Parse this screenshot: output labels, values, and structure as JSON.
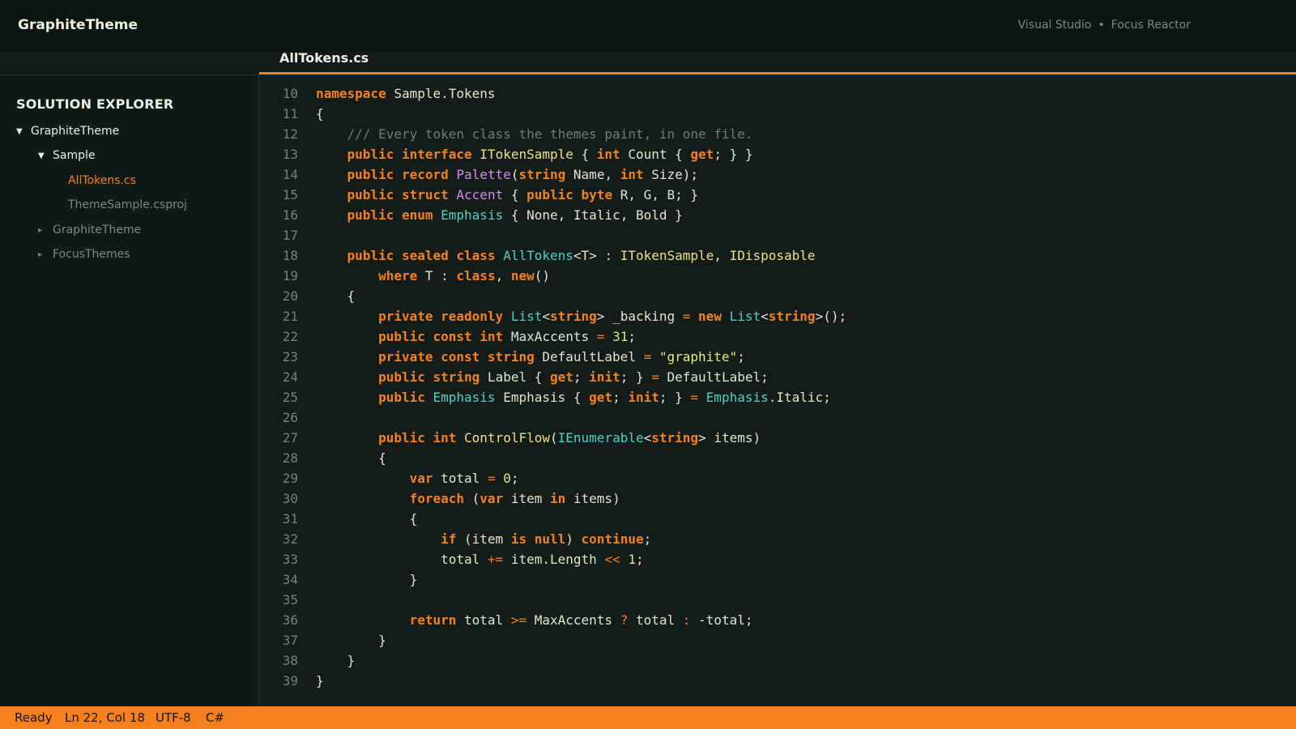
{
  "app_title": "GraphiteTheme",
  "title_right": [
    "Visual Studio",
    "Focus Reactor"
  ],
  "title_separator": "•",
  "tab": {
    "label": "AllTokens.cs"
  },
  "sidebar": {
    "header": "SOLUTION EXPLORER",
    "items": [
      {
        "label": "GraphiteTheme",
        "arrow": "▼",
        "state": "expanded"
      },
      {
        "label": "Sample",
        "arrow": "▼",
        "state": "expanded"
      },
      {
        "label": "AllTokens.cs",
        "arrow": "",
        "state": "active"
      },
      {
        "label": "ThemeSample.csproj",
        "arrow": "",
        "state": "file"
      },
      {
        "label": "GraphiteTheme",
        "arrow": "▸",
        "state": "collapsed"
      },
      {
        "label": "FocusThemes",
        "arrow": "▸",
        "state": "collapsed"
      }
    ]
  },
  "colors": {
    "accent": "#f3811d",
    "keyword": "#f4821e",
    "type": "#4fd1c5",
    "record_type": "#d68cf0",
    "method": "#ece08a",
    "string": "#dbf07a",
    "comment": "#6f7f7a",
    "active_file": "#f4821e",
    "inactive_item": "#7a8a85"
  },
  "code": [
    {
      "n": "10",
      "t": [
        [
          "kw",
          "namespace"
        ],
        [
          "id",
          " Sample.Tokens"
        ]
      ]
    },
    {
      "n": "11",
      "t": [
        [
          "id",
          "{"
        ]
      ]
    },
    {
      "n": "12",
      "t": [
        [
          "id",
          "    "
        ],
        [
          "cm",
          "/// Every token class the themes paint, in one file."
        ]
      ]
    },
    {
      "n": "13",
      "t": [
        [
          "id",
          "    "
        ],
        [
          "kw",
          "public interface"
        ],
        [
          "id",
          " "
        ],
        [
          "fn",
          "ITokenSample"
        ],
        [
          "id",
          " { "
        ],
        [
          "kw",
          "int"
        ],
        [
          "id",
          " Count { "
        ],
        [
          "kw",
          "get"
        ],
        [
          "id",
          "; } }"
        ]
      ]
    },
    {
      "n": "14",
      "t": [
        [
          "id",
          "    "
        ],
        [
          "kw",
          "public record"
        ],
        [
          "id",
          " "
        ],
        [
          "pu",
          "Palette"
        ],
        [
          "id",
          "("
        ],
        [
          "kw",
          "string"
        ],
        [
          "id",
          " Name, "
        ],
        [
          "kw",
          "int"
        ],
        [
          "id",
          " Size);"
        ]
      ]
    },
    {
      "n": "15",
      "t": [
        [
          "id",
          "    "
        ],
        [
          "kw",
          "public struct"
        ],
        [
          "id",
          " "
        ],
        [
          "pu",
          "Accent"
        ],
        [
          "id",
          " { "
        ],
        [
          "kw",
          "public byte"
        ],
        [
          "id",
          " R, G, B; }"
        ]
      ]
    },
    {
      "n": "16",
      "t": [
        [
          "id",
          "    "
        ],
        [
          "kw",
          "public enum"
        ],
        [
          "id",
          " "
        ],
        [
          "ty",
          "Emphasis"
        ],
        [
          "id",
          " { None, Italic, Bold }"
        ]
      ]
    },
    {
      "n": "17",
      "t": []
    },
    {
      "n": "18",
      "t": [
        [
          "id",
          "    "
        ],
        [
          "kw",
          "public sealed class"
        ],
        [
          "id",
          " "
        ],
        [
          "ty",
          "AllTokens"
        ],
        [
          "id",
          "<T> : "
        ],
        [
          "fn",
          "ITokenSample"
        ],
        [
          "id",
          ", "
        ],
        [
          "fn",
          "IDisposable"
        ]
      ]
    },
    {
      "n": "19",
      "t": [
        [
          "id",
          "        "
        ],
        [
          "kw",
          "where"
        ],
        [
          "id",
          " T : "
        ],
        [
          "kw",
          "class"
        ],
        [
          "id",
          ", "
        ],
        [
          "kw",
          "new"
        ],
        [
          "id",
          "()"
        ]
      ]
    },
    {
      "n": "20",
      "t": [
        [
          "id",
          "    {"
        ]
      ]
    },
    {
      "n": "21",
      "t": [
        [
          "id",
          "        "
        ],
        [
          "kw",
          "private readonly"
        ],
        [
          "id",
          " "
        ],
        [
          "ty",
          "List"
        ],
        [
          "id",
          "<"
        ],
        [
          "kw",
          "string"
        ],
        [
          "id",
          "> _backing "
        ],
        [
          "op",
          "="
        ],
        [
          "id",
          " "
        ],
        [
          "kw",
          "new"
        ],
        [
          "id",
          " "
        ],
        [
          "ty",
          "List"
        ],
        [
          "id",
          "<"
        ],
        [
          "kw",
          "string"
        ],
        [
          "id",
          ">();"
        ]
      ]
    },
    {
      "n": "22",
      "t": [
        [
          "id",
          "        "
        ],
        [
          "kw",
          "public const int"
        ],
        [
          "id",
          " MaxAccents "
        ],
        [
          "op",
          "="
        ],
        [
          "id",
          " "
        ],
        [
          "nu",
          "31"
        ],
        [
          "id",
          ";"
        ]
      ]
    },
    {
      "n": "23",
      "t": [
        [
          "id",
          "        "
        ],
        [
          "kw",
          "private const string"
        ],
        [
          "id",
          " DefaultLabel "
        ],
        [
          "op",
          "="
        ],
        [
          "id",
          " "
        ],
        [
          "st",
          "\"graphite\""
        ],
        [
          "id",
          ";"
        ]
      ]
    },
    {
      "n": "24",
      "t": [
        [
          "id",
          "        "
        ],
        [
          "kw",
          "public string"
        ],
        [
          "id",
          " Label { "
        ],
        [
          "kw",
          "get"
        ],
        [
          "id",
          "; "
        ],
        [
          "kw",
          "init"
        ],
        [
          "id",
          "; } "
        ],
        [
          "op",
          "="
        ],
        [
          "id",
          " DefaultLabel;"
        ]
      ]
    },
    {
      "n": "25",
      "t": [
        [
          "id",
          "        "
        ],
        [
          "kw",
          "public"
        ],
        [
          "id",
          " "
        ],
        [
          "ty",
          "Emphasis"
        ],
        [
          "id",
          " Emphasis { "
        ],
        [
          "kw",
          "get"
        ],
        [
          "id",
          "; "
        ],
        [
          "kw",
          "init"
        ],
        [
          "id",
          "; } "
        ],
        [
          "op",
          "="
        ],
        [
          "id",
          " "
        ],
        [
          "ty",
          "Emphasis"
        ],
        [
          "id",
          ".Italic;"
        ]
      ]
    },
    {
      "n": "26",
      "t": []
    },
    {
      "n": "27",
      "t": [
        [
          "id",
          "        "
        ],
        [
          "kw",
          "public int"
        ],
        [
          "id",
          " "
        ],
        [
          "fn",
          "ControlFlow"
        ],
        [
          "id",
          "("
        ],
        [
          "ty",
          "IEnumerable"
        ],
        [
          "id",
          "<"
        ],
        [
          "kw",
          "string"
        ],
        [
          "id",
          "> items)"
        ]
      ]
    },
    {
      "n": "28",
      "t": [
        [
          "id",
          "        {"
        ]
      ]
    },
    {
      "n": "29",
      "t": [
        [
          "id",
          "            "
        ],
        [
          "kw",
          "var"
        ],
        [
          "id",
          " total "
        ],
        [
          "op",
          "="
        ],
        [
          "id",
          " "
        ],
        [
          "nu",
          "0"
        ],
        [
          "id",
          ";"
        ]
      ]
    },
    {
      "n": "30",
      "t": [
        [
          "id",
          "            "
        ],
        [
          "kw",
          "foreach"
        ],
        [
          "id",
          " ("
        ],
        [
          "kw",
          "var"
        ],
        [
          "id",
          " item "
        ],
        [
          "kw",
          "in"
        ],
        [
          "id",
          " items)"
        ]
      ]
    },
    {
      "n": "31",
      "t": [
        [
          "id",
          "            {"
        ]
      ]
    },
    {
      "n": "32",
      "t": [
        [
          "id",
          "                "
        ],
        [
          "kw",
          "if"
        ],
        [
          "id",
          " (item "
        ],
        [
          "kw",
          "is null"
        ],
        [
          "id",
          ") "
        ],
        [
          "kw",
          "continue"
        ],
        [
          "id",
          ";"
        ]
      ]
    },
    {
      "n": "33",
      "t": [
        [
          "id",
          "                total "
        ],
        [
          "op",
          "+="
        ],
        [
          "id",
          " item.Length "
        ],
        [
          "op",
          "<<"
        ],
        [
          "id",
          " "
        ],
        [
          "nu",
          "1"
        ],
        [
          "id",
          ";"
        ]
      ]
    },
    {
      "n": "34",
      "t": [
        [
          "id",
          "            }"
        ]
      ]
    },
    {
      "n": "35",
      "t": []
    },
    {
      "n": "36",
      "t": [
        [
          "id",
          "            "
        ],
        [
          "kw",
          "return"
        ],
        [
          "id",
          " total "
        ],
        [
          "op",
          ">="
        ],
        [
          "id",
          " MaxAccents "
        ],
        [
          "op",
          "?"
        ],
        [
          "id",
          " total "
        ],
        [
          "op",
          ":"
        ],
        [
          "id",
          " -total;"
        ]
      ]
    },
    {
      "n": "37",
      "t": [
        [
          "id",
          "        }"
        ]
      ]
    },
    {
      "n": "38",
      "t": [
        [
          "id",
          "    }"
        ]
      ]
    },
    {
      "n": "39",
      "t": [
        [
          "id",
          "}"
        ]
      ]
    }
  ],
  "status": {
    "state": "Ready",
    "position": "Ln 22, Col 18",
    "encoding": "UTF-8",
    "language": "C#"
  }
}
